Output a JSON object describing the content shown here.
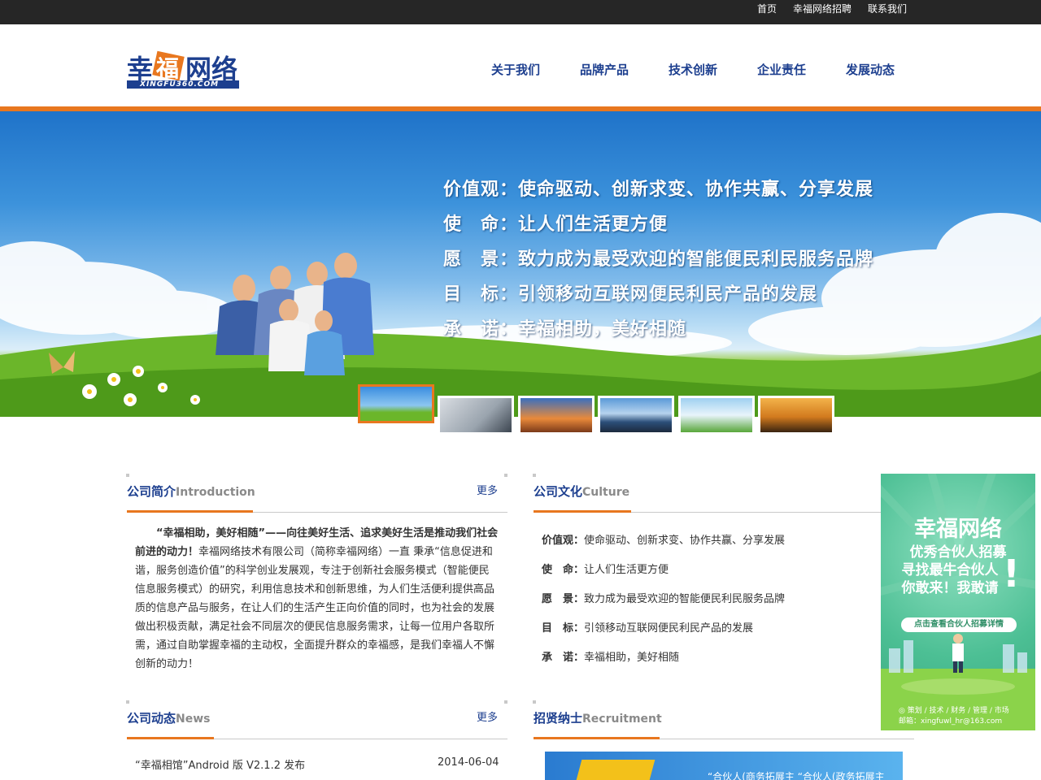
{
  "topbar": {
    "home": "首页",
    "jobs": "幸福网络招聘",
    "contact": "联系我们"
  },
  "logo": {
    "cn": "幸福网络",
    "en": "XINGFU360.COM"
  },
  "nav": [
    "关于我们",
    "品牌产品",
    "技术创新",
    "企业责任",
    "发展动态"
  ],
  "banner": {
    "mottos": [
      "价值观：使命驱动、创新求变、协作共赢、分享发展",
      "使　命：让人们生活更方便",
      "愿　景：致力成为最受欢迎的智能便民利民服务品牌",
      "目　标：引领移动互联网便民利民产品的发展",
      "承　诺：幸福相助，美好相随"
    ],
    "active_thumb": 1
  },
  "intro": {
    "title": "公司简介",
    "title_en": "Introduction",
    "more": "更多",
    "lead": "“幸福相助，美好相随”——向往美好生活、追求美好生活是推动我们社会前进的动力！",
    "body": "幸福网络技术有限公司（简称幸福网络）一直 秉承“信息促进和谐，服务创造价值”的科学创业发展观，专注于创新社会服务模式（智能便民信息服务模式）的研究，利用信息技术和创新思维，为人们生活便利提供高品质的信息产品与服务，在让人们的生活产生正向价值的同时，也为社会的发展做出积极贡献，满足社会不同层次的便民信息服务需求，让每一位用户各取所需，通过自助掌握幸福的主动权，全面提升群众的幸福感，是我们幸福人不懈创新的动力！"
  },
  "culture": {
    "title": "公司文化",
    "title_en": "Culture",
    "rows": [
      {
        "label": "价值观：",
        "text": "使命驱动、创新求变、协作共赢、分享发展"
      },
      {
        "label": "使　命：",
        "text": "让人们生活更方便"
      },
      {
        "label": "愿　景：",
        "text": "致力成为最受欢迎的智能便民利民服务品牌"
      },
      {
        "label": "目　标：",
        "text": "引领移动互联网便民利民产品的发展"
      },
      {
        "label": "承　诺：",
        "text": "幸福相助，美好相随"
      }
    ]
  },
  "news": {
    "title": "公司动态",
    "title_en": "News",
    "more": "更多",
    "items": [
      {
        "title": "“幸福相馆”Android 版 V2.1.2 发布",
        "date": "2014-06-04"
      }
    ]
  },
  "recruit": {
    "title": "招贤纳士",
    "title_en": "Recruitment",
    "img_text": "“合伙人(商务拓展主  “合伙人(政务拓展主"
  },
  "ad": {
    "line1": "幸福网络",
    "line2": "优秀合伙人招募",
    "line3": "寻找最牛合伙人",
    "line4": "你敢来！我敢请",
    "exclaim": "!",
    "button": "点击查看合伙人招募详情",
    "foot1": "◎ 策划 / 技术 / 财务 / 管理 / 市场",
    "foot2": "邮箱：xingfuwl_hr@163.com"
  }
}
